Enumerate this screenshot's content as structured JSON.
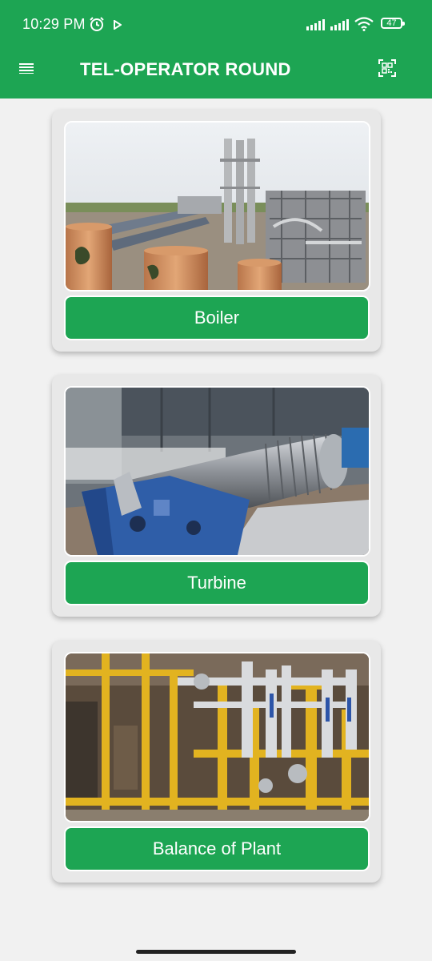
{
  "status_bar": {
    "time": "10:29 PM",
    "battery": "47",
    "icons": [
      "alarm-icon",
      "play-icon",
      "signal-icon",
      "signal-icon",
      "wifi-icon",
      "battery-icon"
    ]
  },
  "app_bar": {
    "title": "TEL-OPERATOR ROUND",
    "left_icon": "menu-icon",
    "right_icon": "qr-code-scan-icon",
    "color": "#1da553"
  },
  "cards": [
    {
      "label": "Boiler",
      "image": "boiler-plant-photo"
    },
    {
      "label": "Turbine",
      "image": "steam-turbine-photo"
    },
    {
      "label": "Balance of Plant",
      "image": "piping-valves-photo"
    }
  ]
}
